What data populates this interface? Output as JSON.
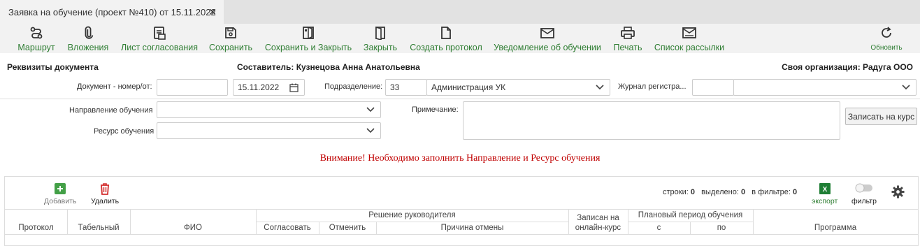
{
  "tab": {
    "title": "Заявка на обучение (проект №410) от 15.11.2022",
    "close_icon": "close-icon"
  },
  "toolbar": {
    "route": "Маршрут",
    "attachments": "Вложения",
    "approval_sheet": "Лист согласования",
    "save": "Сохранить",
    "save_close": "Сохранить и Закрыть",
    "close": "Закрыть",
    "create_protocol": "Создать протокол",
    "notify_training": "Уведомление об обучении",
    "print": "Печать",
    "mailing_list": "Список рассылки",
    "refresh": "Обновить"
  },
  "header": {
    "doc_requisites": "Реквизиты документа",
    "author": "Составитель: Кузнецова Анна Анатольевна",
    "own_org": "Своя организация: Радуга ООО"
  },
  "form": {
    "doc_number_label": "Документ - номер/от:",
    "doc_number_value": "",
    "doc_date_value": "15.11.2022",
    "department_label": "Подразделение:",
    "department_code": "33",
    "department_name": "Администрация УК",
    "journal_label": "Журнал регистра...",
    "journal_code": "",
    "journal_name": "",
    "direction_label": "Направление обучения",
    "direction_value": "",
    "resource_label": "Ресурс обучения",
    "resource_value": "",
    "note_label": "Примечание:",
    "note_value": "",
    "enroll_button": "Записать на курс"
  },
  "warning": "Внимание! Необходимо заполнить Направление и Ресурс обучения",
  "grid": {
    "add": "Добавить",
    "delete": "Удалить",
    "rows_label": "строки:",
    "rows_value": "0",
    "selected_label": "выделено:",
    "selected_value": "0",
    "filtered_label": "в фильтре:",
    "filtered_value": "0",
    "export": "экспорт",
    "filter": "фильтр",
    "columns": {
      "protocol": "Протокол",
      "tab_number": "Табельный",
      "fio": "ФИО",
      "manager_decision": "Решение руководителя",
      "approve": "Согласовать",
      "cancel": "Отменить",
      "cancel_reason": "Причина отмены",
      "online_1": "Записан на",
      "online_2": "онлайн-курс",
      "planned_period": "Плановый период обучения",
      "from": "с",
      "to": "по",
      "program": "Программа"
    }
  },
  "colors": {
    "accent_green": "#2e7d32",
    "warning_red": "#c00000",
    "delete_red": "#d32f2f",
    "add_green": "#43a047",
    "excel_green": "#1e7e34"
  }
}
